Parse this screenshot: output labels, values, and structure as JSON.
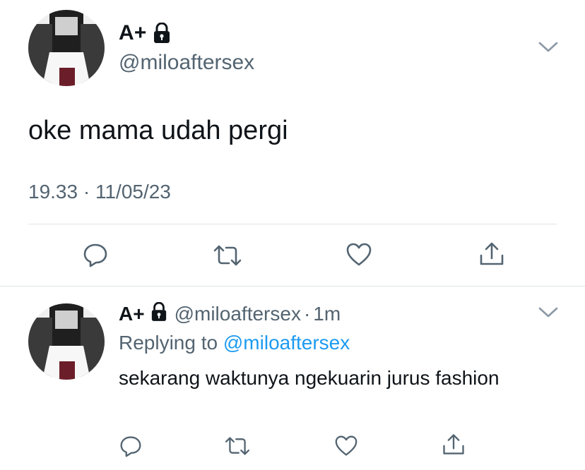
{
  "main_tweet": {
    "display_name": "A+",
    "handle": "@miloaftersex",
    "text": "oke mama udah pergi",
    "time": "19.33",
    "date": "11/05/23",
    "meta_separator": "·"
  },
  "reply_tweet": {
    "display_name": "A+",
    "handle": "@miloaftersex",
    "separator": "·",
    "age": "1m",
    "replying_label": "Replying to",
    "replying_handle": "@miloaftersex",
    "text": "sekarang waktunya ngekuarin jurus fashion"
  },
  "icons": {
    "lock": "lock-icon",
    "reply": "reply-icon",
    "retweet": "retweet-icon",
    "like": "heart-icon",
    "share": "share-icon",
    "more": "chevron-down-icon"
  },
  "colors": {
    "text": "#0f1419",
    "secondary": "#536471",
    "link": "#1d9bf0",
    "divider": "#dfe3e6"
  }
}
